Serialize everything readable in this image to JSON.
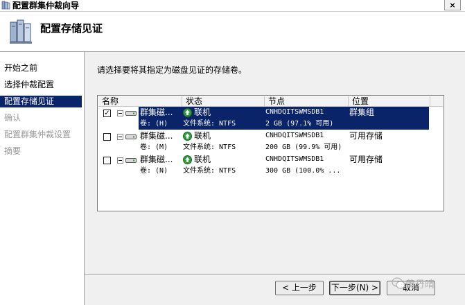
{
  "window": {
    "title": "配置群集仲裁向导",
    "close_label": "×"
  },
  "header": {
    "title": "配置存储见证"
  },
  "nav": {
    "items": [
      {
        "label": "开始之前",
        "state": "normal"
      },
      {
        "label": "选择仲裁配置",
        "state": "normal"
      },
      {
        "label": "配置存储见证",
        "state": "current"
      },
      {
        "label": "确认",
        "state": "disabled"
      },
      {
        "label": "配置群集仲裁设置",
        "state": "disabled"
      },
      {
        "label": "摘要",
        "state": "disabled"
      }
    ]
  },
  "main": {
    "instruction": "请选择要将其指定为磁盘见证的存储卷。",
    "columns": [
      "名称",
      "状态",
      "节点",
      "位置"
    ],
    "rows": [
      {
        "checked": true,
        "selected": true,
        "name": "群集磁...",
        "status": "联机",
        "node": "CNHDQITSWMSDB1",
        "location": "群集组",
        "volume": "卷: (H)",
        "filesystem": "文件系统: NTFS",
        "capacity": "2 GB (97.1% 可用)"
      },
      {
        "checked": false,
        "selected": false,
        "name": "群集磁...",
        "status": "联机",
        "node": "CNHDQITSWMSDB1",
        "location": "可用存储",
        "volume": "卷: (M)",
        "filesystem": "文件系统: NTFS",
        "capacity": "200 GB (99.9% 可用)"
      },
      {
        "checked": false,
        "selected": false,
        "name": "群集磁...",
        "status": "联机",
        "node": "CNHDQITSWMSDB1",
        "location": "可用存储",
        "volume": "卷: (N)",
        "filesystem": "文件系统: NTFS",
        "capacity": "300 GB (100.0% ..."
      }
    ]
  },
  "buttons": {
    "prev": "< 上一步",
    "next": "下一步(N) >",
    "cancel": "取消"
  },
  "watermark": {
    "text": "黄丹晴"
  },
  "colors": {
    "selection": "#0a246a",
    "status_green": "#2e9a3a",
    "disabled_text": "#9a9a9a"
  }
}
